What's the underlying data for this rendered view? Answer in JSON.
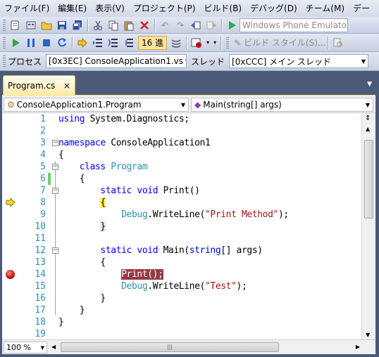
{
  "menu": [
    "ファイル(F)",
    "編集(E)",
    "表示(V)",
    "プロジェクト(P)",
    "ビルド(B)",
    "デバッグ(D)",
    "チーム(M)",
    "デー"
  ],
  "toolbar": {
    "emulator": "Windows Phone Emulator",
    "hex": "16 進",
    "build_style": "ビルド スタイル(S)..."
  },
  "debugbar": {
    "process_label": "プロセス",
    "process_value": "[0x3EC] ConsoleApplication1.vs",
    "thread_label": "スレッド",
    "thread_value": "[0xCCC] メイン スレッド"
  },
  "tab": {
    "title": "Program.cs",
    "close": "×"
  },
  "nav": {
    "left": "ConsoleApplication1.Program",
    "right": "Main(string[] args)"
  },
  "code": {
    "l1": [
      "using",
      " System.Diagnostics;"
    ],
    "l3": [
      "namespace",
      " ConsoleApplication1"
    ],
    "l4": "{",
    "l5": [
      "class",
      "Program"
    ],
    "l6": "{",
    "l7": [
      "static",
      "void",
      " Print()"
    ],
    "l8": "{",
    "l9": [
      "Debug",
      ".WriteLine(",
      "\"Print Method\"",
      ");"
    ],
    "l10": "}",
    "l12": [
      "static",
      "void",
      " Main(",
      "string",
      "[] args)"
    ],
    "l13": "{",
    "l14": "Print();",
    "l15": [
      "Debug",
      ".WriteLine(",
      "\"Test\"",
      ");"
    ],
    "l16": "}",
    "l17": "}",
    "l18": "}"
  },
  "line_numbers": [
    "1",
    "2",
    "3",
    "4",
    "5",
    "6",
    "7",
    "8",
    "9",
    "10",
    "11",
    "12",
    "13",
    "14",
    "15",
    "16",
    "17",
    "18",
    "19"
  ],
  "zoom": "100 %",
  "colors": {
    "keyword": "#0000ff",
    "type": "#2b91af",
    "string": "#a31515",
    "breakpoint": "#963a46",
    "current": "#ffee62",
    "saved_change": "#6fcf6f"
  }
}
